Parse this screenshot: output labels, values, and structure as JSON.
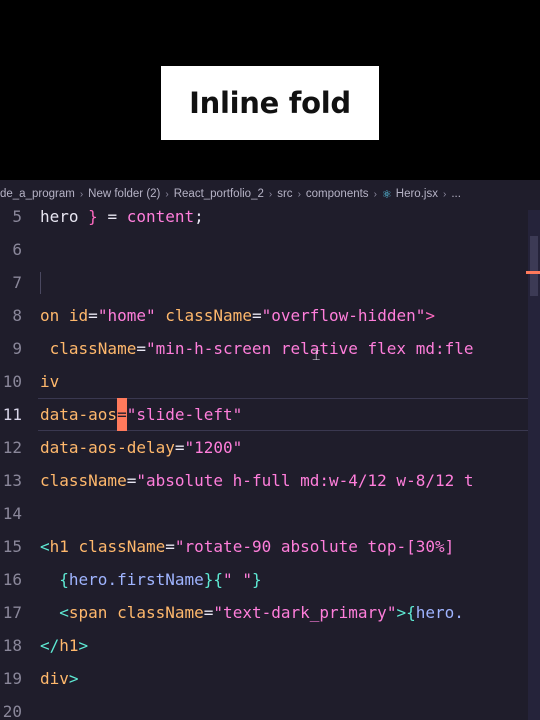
{
  "caption": "Inline fold",
  "breadcrumb": [
    "de_a_program",
    "New folder (2)",
    "React_portfolio_2",
    "src",
    "components",
    "Hero.jsx",
    "..."
  ],
  "colors": {
    "accent": "#ff7a5c",
    "react": "#61dafb",
    "background": "#1f1d2b"
  },
  "icons": {
    "file": "react-icon"
  },
  "lines": [
    {
      "n": "5",
      "segs": [
        [
          "hero ",
          "plain"
        ],
        [
          "}",
          "kw"
        ],
        [
          " = ",
          "plain"
        ],
        [
          "content",
          "str"
        ],
        [
          ";",
          "plain"
        ]
      ]
    },
    {
      "n": "6",
      "segs": []
    },
    {
      "n": "7",
      "segs": []
    },
    {
      "n": "8",
      "segs": [
        [
          "on ",
          "attr"
        ],
        [
          "id",
          "attr"
        ],
        [
          "=",
          "plain"
        ],
        [
          "\"home\"",
          "str"
        ],
        [
          " ",
          "plain"
        ],
        [
          "className",
          "attr"
        ],
        [
          "=",
          "plain"
        ],
        [
          "\"overflow-hidden\"",
          "str"
        ],
        [
          ">",
          "kw"
        ]
      ]
    },
    {
      "n": "9",
      "segs": [
        [
          " className",
          "attr"
        ],
        [
          "=",
          "plain"
        ],
        [
          "\"min-h-screen relative flex md:fle",
          "str"
        ]
      ]
    },
    {
      "n": "10",
      "segs": [
        [
          "iv",
          "attr"
        ]
      ]
    },
    {
      "n": "11",
      "segs": [
        [
          "data-aos",
          "attr"
        ],
        [
          "=",
          "cursor"
        ],
        [
          "\"slide-left\"",
          "str"
        ]
      ],
      "active": true
    },
    {
      "n": "12",
      "segs": [
        [
          "data-aos-delay",
          "attr"
        ],
        [
          "=",
          "plain"
        ],
        [
          "\"1200\"",
          "str"
        ]
      ]
    },
    {
      "n": "13",
      "segs": [
        [
          "className",
          "attr"
        ],
        [
          "=",
          "plain"
        ],
        [
          "\"absolute h-full md:w-4/12 w-8/12 t",
          "str"
        ]
      ]
    },
    {
      "n": "14",
      "segs": []
    },
    {
      "n": "15",
      "segs": [
        [
          "<",
          "teal"
        ],
        [
          "h1",
          "attr"
        ],
        [
          " ",
          "plain"
        ],
        [
          "className",
          "attr"
        ],
        [
          "=",
          "plain"
        ],
        [
          "\"rotate-90 absolute top-[30%] ",
          "str"
        ]
      ]
    },
    {
      "n": "16",
      "segs": [
        [
          "  ",
          "plain"
        ],
        [
          "{",
          "teal"
        ],
        [
          "hero.firstName",
          "var"
        ],
        [
          "}",
          "teal"
        ],
        [
          "{",
          "teal"
        ],
        [
          "\" \"",
          "str"
        ],
        [
          "}",
          "teal"
        ]
      ]
    },
    {
      "n": "17",
      "segs": [
        [
          "  ",
          "plain"
        ],
        [
          "<",
          "teal"
        ],
        [
          "span",
          "attr"
        ],
        [
          " ",
          "plain"
        ],
        [
          "className",
          "attr"
        ],
        [
          "=",
          "plain"
        ],
        [
          "\"text-dark_primary\"",
          "str"
        ],
        [
          ">",
          "teal"
        ],
        [
          "{",
          "teal"
        ],
        [
          "hero.",
          "var"
        ]
      ]
    },
    {
      "n": "18",
      "segs": [
        [
          "</",
          "teal"
        ],
        [
          "h1",
          "attr"
        ],
        [
          ">",
          "teal"
        ]
      ]
    },
    {
      "n": "19",
      "segs": [
        [
          "div",
          "attr"
        ],
        [
          ">",
          "teal"
        ]
      ]
    },
    {
      "n": "20",
      "segs": []
    }
  ]
}
